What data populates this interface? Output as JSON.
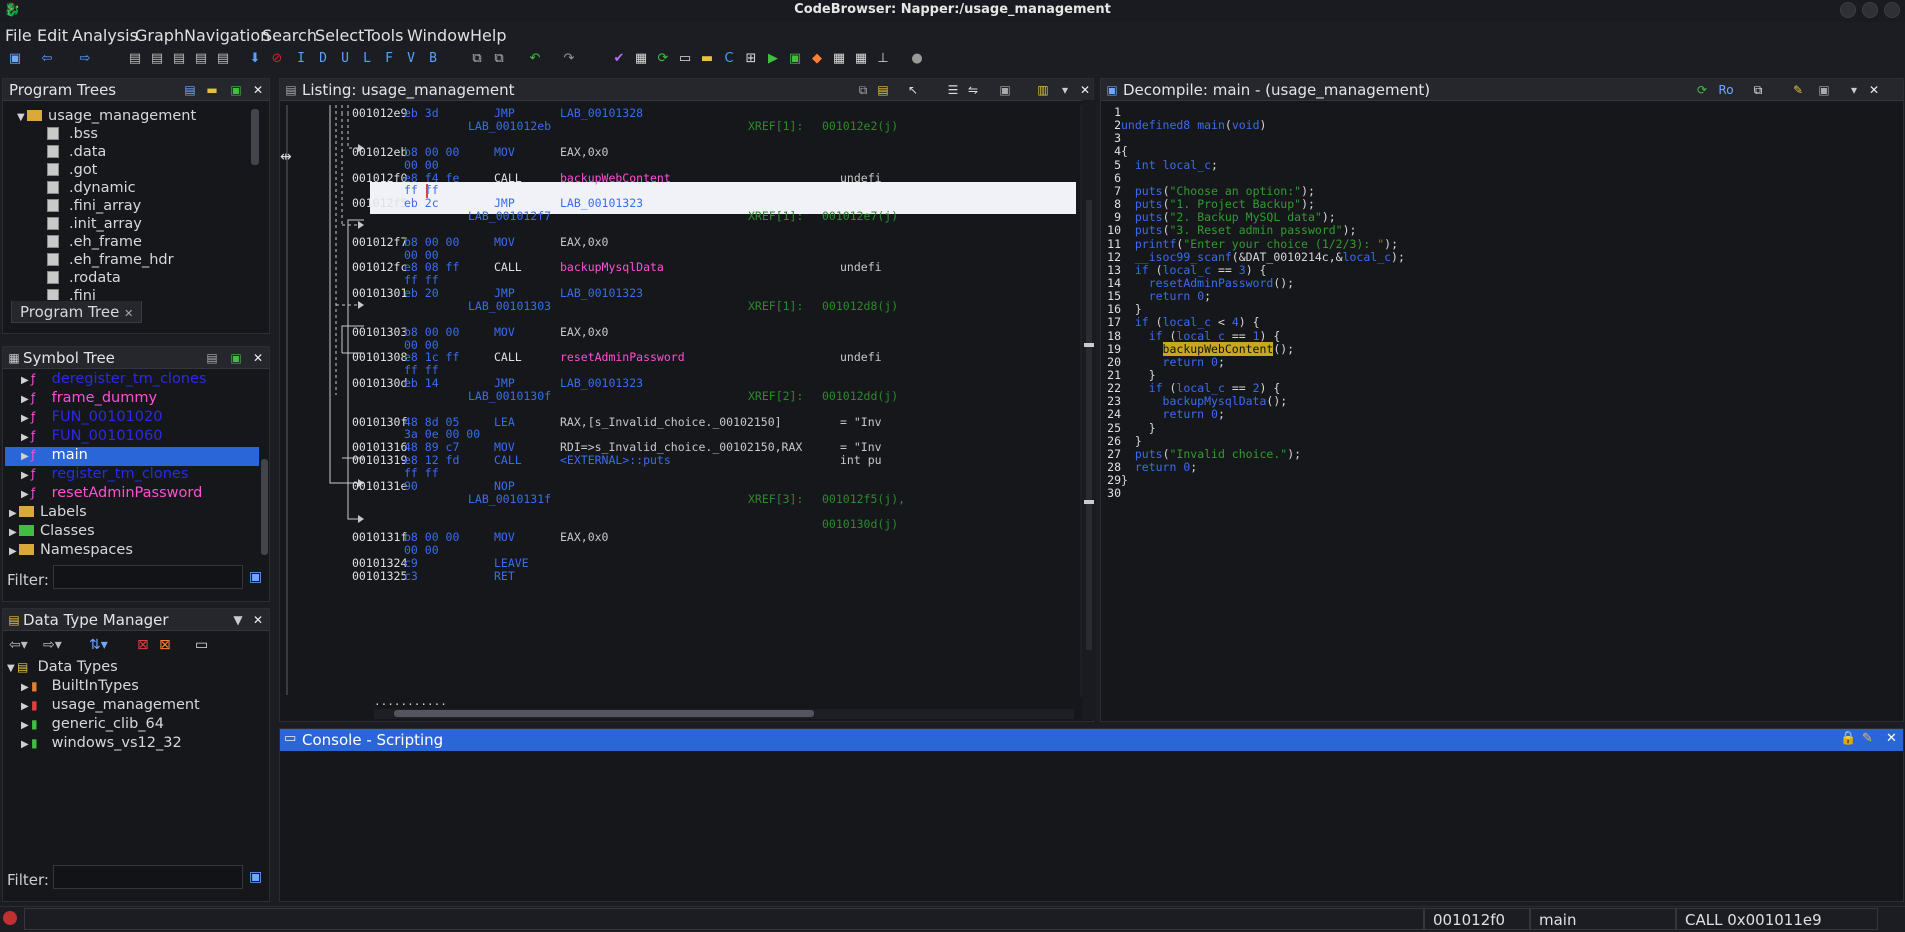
{
  "window": {
    "title": "CodeBrowser: Napper:/usage_management"
  },
  "menu": [
    "File",
    "Edit",
    "Analysis",
    "Graph",
    "Navigation",
    "Search",
    "Select",
    "Tools",
    "Window",
    "Help"
  ],
  "program_trees": {
    "title": "Program Trees",
    "root": "usage_management",
    "items": [
      ".bss",
      ".data",
      ".got",
      ".dynamic",
      ".fini_array",
      ".init_array",
      ".eh_frame",
      ".eh_frame_hdr",
      ".rodata",
      ".fini"
    ],
    "tab": "Program Tree"
  },
  "symbol_tree": {
    "title": "Symbol Tree",
    "functions": [
      "deregister_tm_clones",
      "frame_dummy",
      "FUN_00101020",
      "FUN_00101060",
      "main",
      "register_tm_clones",
      "resetAdminPassword"
    ],
    "selected": "main",
    "groups": [
      "Labels",
      "Classes",
      "Namespaces"
    ],
    "filter_label": "Filter:"
  },
  "data_type_manager": {
    "title": "Data Type Manager",
    "root": "Data Types",
    "items": [
      "BuiltInTypes",
      "usage_management",
      "generic_clib_64",
      "windows_vs12_32"
    ],
    "filter_label": "Filter:"
  },
  "listing": {
    "title": "Listing:  usage_management",
    "rows": [
      {
        "addr": "001012e9",
        "bytes": "eb 3d",
        "mn": "JMP",
        "op": "LAB_00101328",
        "type": "jmp"
      },
      {
        "label": "LAB_001012eb",
        "xref": "XREF[1]:",
        "xaddr": "001012e2(j)"
      },
      {
        "addr": "001012eb",
        "bytes": "b8 00 00",
        "mn": "MOV",
        "op": "EAX,0x0",
        "type": "mov"
      },
      {
        "cont": "00 00"
      },
      {
        "addr": "001012f0",
        "bytes": "e8 f4 fe",
        "mn": "CALL",
        "op": "backupWebContent",
        "type": "call",
        "right": "undefi",
        "selected": true
      },
      {
        "cont": "ff ff",
        "selected": true
      },
      {
        "addr": "001012f5",
        "bytes": "eb 2c",
        "mn": "JMP",
        "op": "LAB_00101323",
        "type": "jmp"
      },
      {
        "label": "LAB_001012f7",
        "xref": "XREF[1]:",
        "xaddr": "001012e7(j)"
      },
      {
        "addr": "001012f7",
        "bytes": "b8 00 00",
        "mn": "MOV",
        "op": "EAX,0x0",
        "type": "mov"
      },
      {
        "cont": "00 00"
      },
      {
        "addr": "001012fc",
        "bytes": "e8 08 ff",
        "mn": "CALL",
        "op": "backupMysqlData",
        "type": "call",
        "right": "undefi"
      },
      {
        "cont": "ff ff"
      },
      {
        "addr": "00101301",
        "bytes": "eb 20",
        "mn": "JMP",
        "op": "LAB_00101323",
        "type": "jmp"
      },
      {
        "label": "LAB_00101303",
        "xref": "XREF[1]:",
        "xaddr": "001012d8(j)"
      },
      {
        "addr": "00101303",
        "bytes": "b8 00 00",
        "mn": "MOV",
        "op": "EAX,0x0",
        "type": "mov"
      },
      {
        "cont": "00 00"
      },
      {
        "addr": "00101308",
        "bytes": "e8 1c ff",
        "mn": "CALL",
        "op": "resetAdminPassword",
        "type": "call",
        "right": "undefi"
      },
      {
        "cont": "ff ff"
      },
      {
        "addr": "0010130d",
        "bytes": "eb 14",
        "mn": "JMP",
        "op": "LAB_00101323",
        "type": "jmp"
      },
      {
        "label": "LAB_0010130f",
        "xref": "XREF[2]:",
        "xaddr": "001012dd(j)"
      },
      {
        "addr": "0010130f",
        "bytes": "48 8d 05",
        "mn": "LEA",
        "op": "RAX,[s_Invalid_choice._00102150]",
        "type": "mov",
        "right": "= \"Inv"
      },
      {
        "cont": "3a 0e 00 00"
      },
      {
        "addr": "00101316",
        "bytes": "48 89 c7",
        "mn": "MOV",
        "op": "RDI=>s_Invalid_choice._00102150,RAX",
        "type": "mov",
        "right": "= \"Inv"
      },
      {
        "addr": "00101319",
        "bytes": "e8 12 fd",
        "mn": "CALL",
        "op": "<EXTERNAL>::puts",
        "type": "call2",
        "right": "int pu"
      },
      {
        "cont": "ff ff"
      },
      {
        "addr": "0010131e",
        "bytes": "90",
        "mn": "NOP",
        "op": "",
        "type": "jmp"
      },
      {
        "label": "LAB_0010131f",
        "xref": "XREF[3]:",
        "xaddr": "001012f5(j),"
      },
      {
        "cont2": "0010130d(j)"
      },
      {
        "addr": "0010131f",
        "bytes": "b8 00 00",
        "mn": "MOV",
        "op": "EAX,0x0",
        "type": "mov"
      },
      {
        "cont": "00 00"
      },
      {
        "addr": "00101324",
        "bytes": "c9",
        "mn": "LEAVE",
        "op": "",
        "type": "jmp"
      },
      {
        "addr": "00101325",
        "bytes": "c3",
        "mn": "RET",
        "op": "",
        "type": "jmp"
      }
    ],
    "dots": "..........."
  },
  "decompile": {
    "title": "Decompile: main -  (usage_management)",
    "lines": [
      "",
      "undefined8 main(void)",
      "",
      "{",
      "  int local_c;",
      "",
      "  puts(\"Choose an option:\");",
      "  puts(\"1. Project Backup\");",
      "  puts(\"2. Backup MySQL data\");",
      "  puts(\"3. Reset admin password\");",
      "  printf(\"Enter your choice (1/2/3): \");",
      "  __isoc99_scanf(&DAT_0010214c,&local_c);",
      "  if (local_c == 3) {",
      "    resetAdminPassword();",
      "    return 0;",
      "  }",
      "  if (local_c < 4) {",
      "    if (local_c == 1) {",
      "      backupWebContent();",
      "      return 0;",
      "    }",
      "    if (local_c == 2) {",
      "      backupMysqlData();",
      "      return 0;",
      "    }",
      "  }",
      "  puts(\"Invalid choice.\");",
      "  return 0;",
      "}",
      ""
    ]
  },
  "console": {
    "title": "Console - Scripting"
  },
  "status": {
    "address": "001012f0",
    "function": "main",
    "instruction": "CALL 0x001011e9"
  },
  "colors": {
    "accent": "#2a66d8",
    "function": "#ff4fd8",
    "keyword": "#3a6cf0",
    "string": "#2f9d2f"
  }
}
